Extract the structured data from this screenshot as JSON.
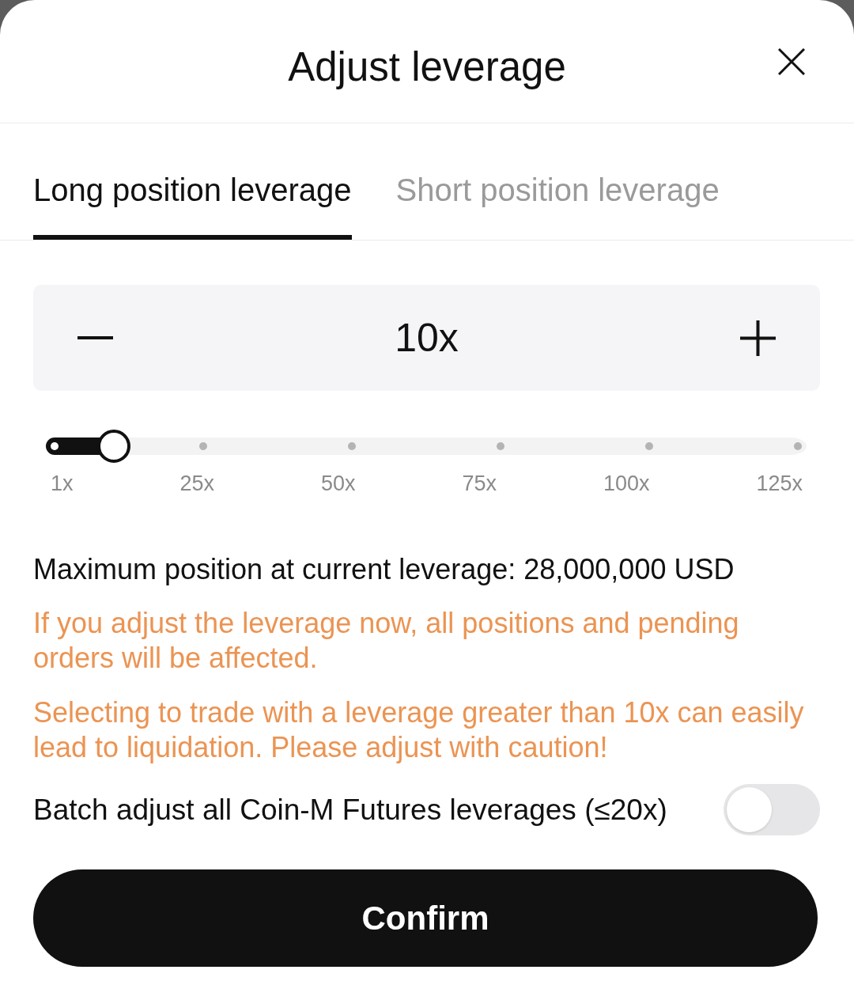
{
  "header": {
    "title": "Adjust leverage"
  },
  "tabs": [
    {
      "label": "Long position leverage",
      "selected": true
    },
    {
      "label": "Short position leverage",
      "selected": false
    }
  ],
  "stepper": {
    "value": "10x"
  },
  "slider": {
    "level": 0.08,
    "marks": [
      "1x",
      "25x",
      "50x",
      "75x",
      "100x",
      "125x"
    ]
  },
  "max_position": "Maximum position at current leverage: 28,000,000 USD",
  "warnings": [
    "If you adjust the leverage now, all positions and pending orders will be affected.",
    "Selecting to trade with a leverage greater than 10x can easily lead to liquidation. Please adjust with caution!"
  ],
  "batch_toggle": {
    "label": "Batch adjust all Coin-M Futures leverages (≤20x)",
    "on": false
  },
  "confirm_button": {
    "label": "Confirm"
  }
}
